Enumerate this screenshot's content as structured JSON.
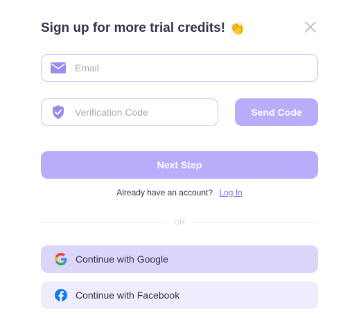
{
  "modal": {
    "title": "Sign up for more trial credits!",
    "title_emoji": "👏"
  },
  "email": {
    "placeholder": "Email",
    "value": ""
  },
  "verification": {
    "placeholder": "Verification Code",
    "value": ""
  },
  "buttons": {
    "send_code": "Send Code",
    "next_step": "Next Step"
  },
  "login": {
    "prompt": "Already have an account?",
    "link": "Log In"
  },
  "divider": {
    "text": "OR"
  },
  "social": {
    "google": "Continue with Google",
    "facebook": "Continue with Facebook"
  },
  "icons": {
    "close": "close-icon",
    "email": "envelope-icon",
    "verification": "shield-check-icon",
    "google": "google-icon",
    "facebook": "facebook-icon"
  },
  "colors": {
    "accent": "#b7adfb",
    "border": "#c9c0f5",
    "link": "#7e6df0",
    "google_bg": "#dcd6fb",
    "facebook_bg": "#eeedfd",
    "facebook_blue": "#1877f2"
  }
}
